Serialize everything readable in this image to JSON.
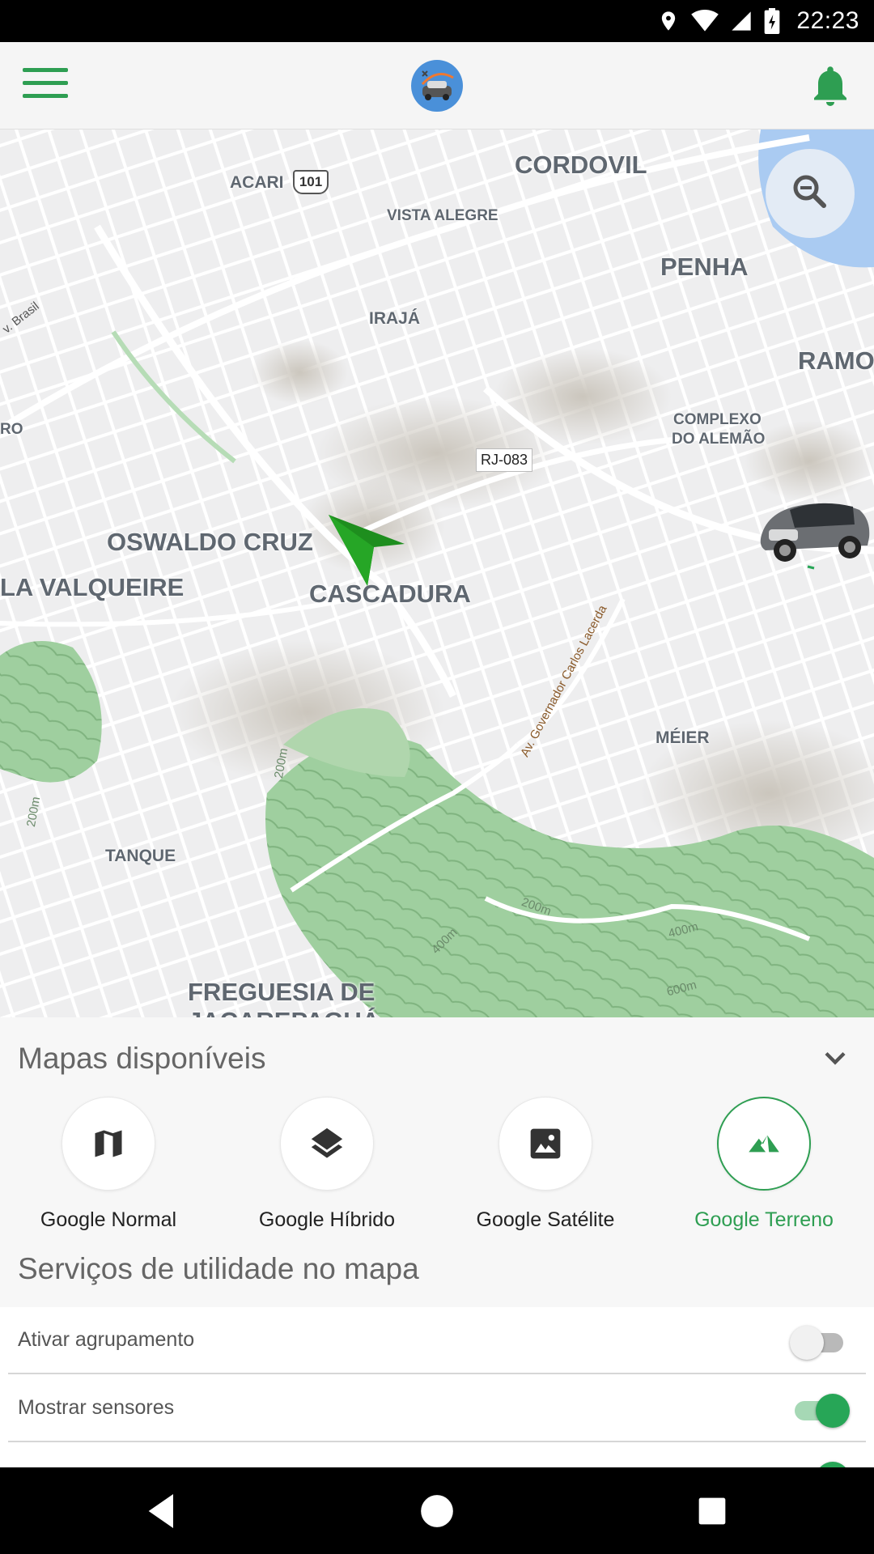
{
  "status_bar": {
    "time": "22:23",
    "icons": [
      "location-icon",
      "wifi-icon",
      "cell-signal-icon",
      "battery-icon"
    ]
  },
  "app_bar": {
    "menu_icon": "hamburger-menu-icon",
    "logo": "app-logo",
    "notification_icon": "bell-icon",
    "accent_color": "#2e9e52"
  },
  "map": {
    "labels": {
      "cordovil": "CORDOVIL",
      "acari": "ACARI",
      "vista_alegre": "VISTA ALEGRE",
      "penha": "PENHA",
      "iraja": "IRAJÁ",
      "ramo": "RAMO",
      "brasil": "v. Brasil",
      "ro": "RO",
      "complexo_1": "COMPLEXO",
      "complexo_2": "DO ALEMÃO",
      "oswaldo_cruz": "OSWALDO CRUZ",
      "valqueire": "LA VALQUEIRE",
      "cascadura": "CASCADURA",
      "meier": "MÉIER",
      "tanque": "TANQUE",
      "freguesia_1": "FREGUESIA DE",
      "freguesia_2": "JACAREPAGUÁ"
    },
    "route_shield": "101",
    "road_badge": "RJ-083",
    "road_names": {
      "carlos_lacerda": "Av. Governador Carlos Lacerda"
    },
    "contour_labels": [
      "200m",
      "200m",
      "200m",
      "400m",
      "400m",
      "600m"
    ],
    "zoom_icon": "zoom-out-icon",
    "vehicle_marker": "car-icon",
    "location_arrow": "navigation-arrow-icon"
  },
  "sheet": {
    "title": "Mapas disponíveis",
    "collapse_icon": "chevron-down-icon",
    "map_types": [
      {
        "label": "Google Normal",
        "icon": "map-icon",
        "active": false
      },
      {
        "label": "Google Híbrido",
        "icon": "layers-icon",
        "active": false
      },
      {
        "label": "Google Satélite",
        "icon": "image-icon",
        "active": false
      },
      {
        "label": "Google Terreno",
        "icon": "terrain-icon",
        "active": true
      }
    ],
    "services_title": "Serviços de utilidade no mapa",
    "settings": [
      {
        "label": "Ativar agrupamento",
        "enabled": false
      },
      {
        "label": "Mostrar sensores",
        "enabled": true
      },
      {
        "label": "",
        "enabled": true
      }
    ]
  },
  "nav_bar": {
    "back_icon": "back-triangle-icon",
    "home_icon": "home-circle-icon",
    "recents_icon": "recents-square-icon"
  }
}
